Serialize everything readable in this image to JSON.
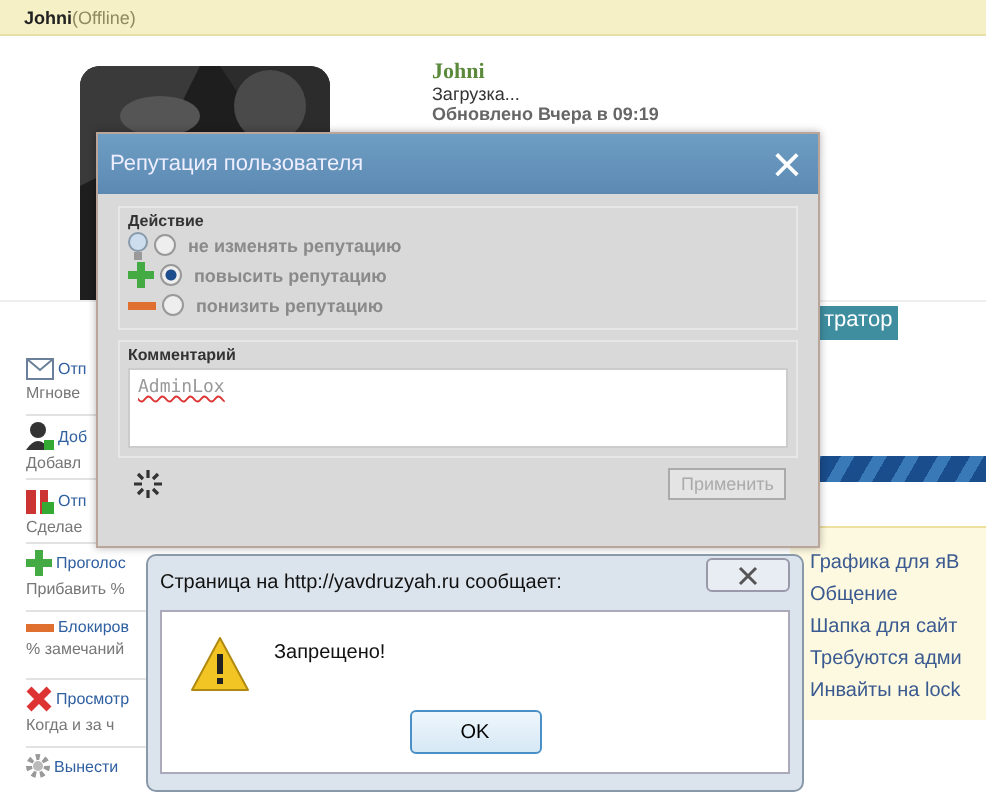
{
  "header": {
    "name": "Johni",
    "status": "(Offline)"
  },
  "profile": {
    "name": "Johni",
    "mood": "Загрузка...",
    "updated": "Обновлено Вчера в 09:19",
    "rank": "тратор"
  },
  "actions": [
    {
      "kind": "mail",
      "title": "Отп",
      "subtitle": "Мгнове"
    },
    {
      "kind": "user",
      "title": "Доб",
      "subtitle": "Добавл"
    },
    {
      "kind": "gift",
      "title": "Отп",
      "subtitle": "Сделае"
    },
    {
      "kind": "plus",
      "title": "Проголос",
      "subtitle": "Прибавить %"
    },
    {
      "kind": "minus",
      "title": "Блокиров",
      "subtitle": "% замечаний"
    },
    {
      "kind": "cross",
      "title": "Просмотр",
      "subtitle": "Когда и за ч"
    },
    {
      "kind": "gear",
      "title": "Вынести"
    }
  ],
  "sidebar": {
    "items": [
      "Графика для яВ",
      "Общение",
      "Шапка для сайт",
      "Требуются адми",
      "Инвайты на lock"
    ]
  },
  "reputation_dialog": {
    "title": "Репутация пользователя",
    "close": "×",
    "action_legend": "Действие",
    "options": [
      {
        "kind": "bulb",
        "label": "не изменять репутацию",
        "selected": false
      },
      {
        "kind": "plus",
        "label": "повысить репутацию",
        "selected": true
      },
      {
        "kind": "minus",
        "label": "понизить репутацию",
        "selected": false
      }
    ],
    "comment_legend": "Комментарий",
    "comment": "AdminLox",
    "apply": {
      "label": "Применить",
      "disabled": true
    }
  },
  "alert": {
    "title": "Страница на http://yavdruzyah.ru сообщает:",
    "message": "Запрещено!",
    "ok": "OK"
  }
}
